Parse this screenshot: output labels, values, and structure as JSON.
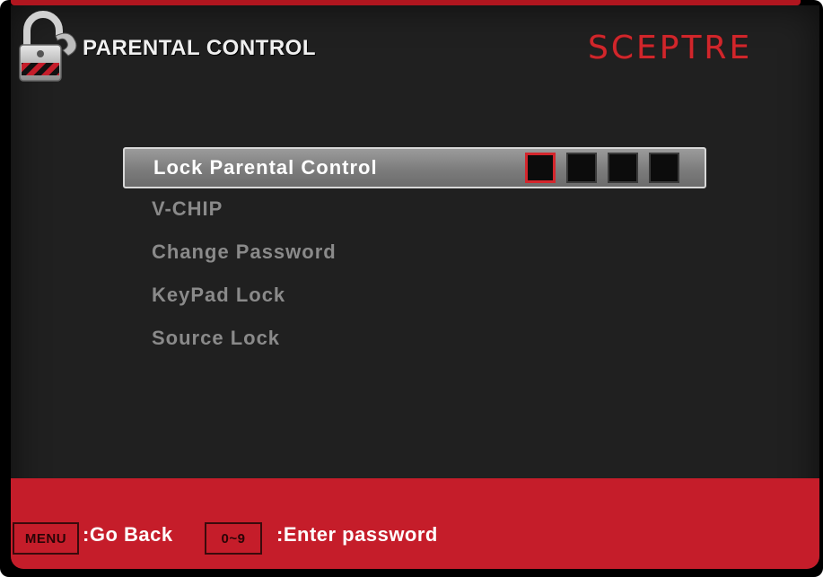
{
  "header": {
    "title": "PARENTAL CONTROL",
    "brand": "SCEPTRE"
  },
  "menu": {
    "items": [
      {
        "label": "Lock Parental Control",
        "selected": true
      },
      {
        "label": "V-CHIP",
        "selected": false
      },
      {
        "label": "Change Password",
        "selected": false
      },
      {
        "label": "KeyPad Lock",
        "selected": false
      },
      {
        "label": "Source Lock",
        "selected": false
      }
    ],
    "pin_slots": 4,
    "active_pin_slot": 1
  },
  "footer": {
    "menu_key": "MENU",
    "menu_action": ":Go Back",
    "digits_key": "0~9",
    "digits_action": ":Enter password"
  },
  "colors": {
    "accent": "#c51d2a",
    "brand": "#d1262b",
    "background": "#202020"
  },
  "icons": {
    "header": "padlock-icon"
  }
}
